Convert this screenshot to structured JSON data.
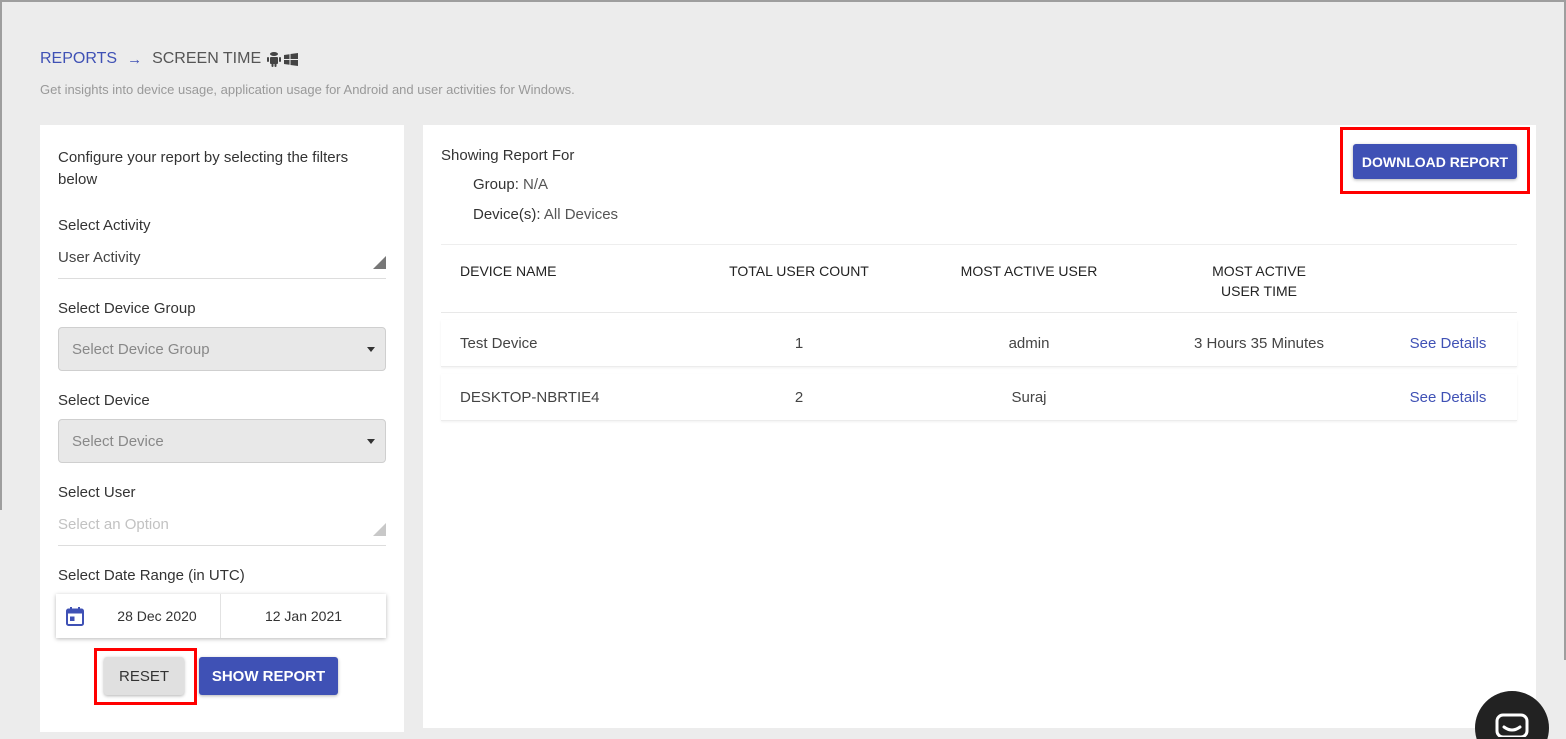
{
  "breadcrumb": {
    "root": "REPORTS",
    "arrow": "→",
    "current": "SCREEN TIME",
    "icons": [
      "android-icon",
      "windows-icon"
    ]
  },
  "subtitle": "Get insights into device usage, application usage for Android and user activities for Windows.",
  "filters": {
    "intro": "Configure your report by selecting the filters below",
    "activity": {
      "label": "Select Activity",
      "value": "User Activity"
    },
    "device_group": {
      "label": "Select Device Group",
      "placeholder": "Select Device Group"
    },
    "device": {
      "label": "Select Device",
      "placeholder": "Select Device"
    },
    "user": {
      "label": "Select User",
      "placeholder": "Select an Option"
    },
    "date_range": {
      "label": "Select Date Range (in UTC)",
      "from": "28 Dec 2020",
      "to": "12 Jan 2021"
    },
    "reset_label": "RESET",
    "show_label": "SHOW REPORT"
  },
  "report": {
    "title": "Showing Report For",
    "group_key": "Group:",
    "group_value": "N/A",
    "devices_key": "Device(s):",
    "devices_value": "All Devices",
    "download_label": "DOWNLOAD REPORT",
    "columns": [
      "DEVICE NAME",
      "TOTAL USER COUNT",
      "MOST ACTIVE USER",
      "MOST ACTIVE USER TIME"
    ],
    "rows": [
      {
        "device": "Test Device",
        "count": "1",
        "user": "admin",
        "time": "3 Hours 35 Minutes",
        "action": "See Details"
      },
      {
        "device": "DESKTOP-NBRTIE4",
        "count": "2",
        "user": "Suraj",
        "time": "",
        "action": "See Details"
      }
    ]
  },
  "colors": {
    "accent": "#3f51b5",
    "highlight": "#ff0000",
    "background": "#ececec"
  }
}
